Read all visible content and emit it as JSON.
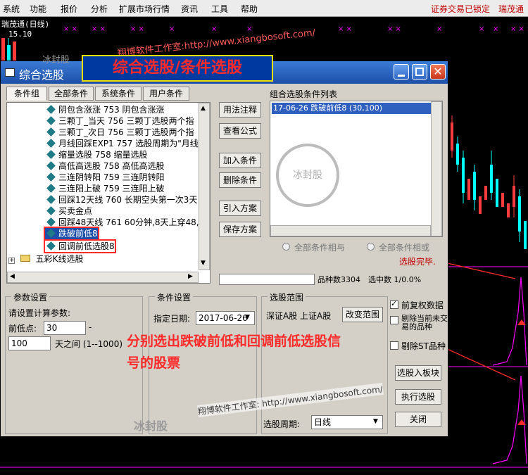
{
  "menubar": {
    "items": [
      "系统",
      "功能",
      "报价",
      "分析",
      "扩展市场行情",
      "资讯",
      "工具",
      "帮助"
    ],
    "status_locked": "证券交易已锁定",
    "stock_name": "瑞茂通"
  },
  "chart": {
    "stock_label": "瑞茂通(日线)",
    "price_label": "15.10"
  },
  "watermark": {
    "top": "翔博软件工作室:http://www.xiangbosoft.com/",
    "bottom": "翔博软件工作室: http://www.xiangbosoft.com/",
    "name_top": "冰封股",
    "name_bottom": "冰封股"
  },
  "banner": "综合选股/条件选股",
  "dialog": {
    "title": "综合选股",
    "tabs": [
      "条件组",
      "全部条件",
      "系统条件",
      "用户条件"
    ],
    "tree_items": [
      "阴包含涨涨 753 阴包含涨涨",
      "三颗丁_当天 756 三颗丁选股两个指",
      "三颗丁_次日 756 三颗丁选股两个指",
      "月线回踩EXP1 757 选股周期为\"月线",
      "缩量选股 758 缩量选股",
      "高低高选股 758 高低高选股",
      "三连阴转阳 759 三连阴转阳",
      "三连阳上破 759 三连阳上破",
      "回踩12天线 760 长期空头第一次3天",
      "买卖金点",
      "回踩48天线 761 60分钟,8天上穿48,",
      "跌破前低8",
      "回调前低选股8"
    ],
    "tree_folder": "五彩K线选股",
    "side_buttons": [
      "用法注释",
      "查看公式",
      "加入条件",
      "删除条件",
      "引入方案",
      "保存方案"
    ],
    "combined_list_label": "组合选股条件列表",
    "combined_list_items": [
      "17-06-26 跌破前低8 (30,100)"
    ],
    "radio_and": "全部条件相与",
    "radio_or": "全部条件相或",
    "status_done": "选股完毕.",
    "variety_count": "品种数3304",
    "selected_count": "选中数 1/0.0%",
    "params": {
      "group_label": "参数设置",
      "prompt": "请设置计算参数:",
      "front_low_label": "前低点:",
      "front_low_value": "30",
      "front_low_suffix": "-",
      "days_value": "100",
      "days_suffix": "天之间 (1--1000)"
    },
    "condition": {
      "group_label": "条件设置",
      "date_label": "指定日期:",
      "date_value": "2017-06-26"
    },
    "range": {
      "group_label": "选股范围",
      "markets": "深证A股 上证A股",
      "change_button": "改变范围",
      "restore_rights": "前复权数据",
      "exclude_unlisted": "剔除当前未交易的品种",
      "exclude_st": "剔除ST品种",
      "period_label": "选股周期:",
      "period_value": "日线"
    },
    "bottom_buttons": [
      "选股入板块",
      "执行选股",
      "关闭"
    ]
  },
  "annotation": "分别选出跌破前低和回调前低选股信号的股票",
  "colors": {
    "up": "#ff3b3b",
    "down": "#00ffff",
    "volume": "#ff00ff",
    "accent": "#ff2a2a"
  }
}
